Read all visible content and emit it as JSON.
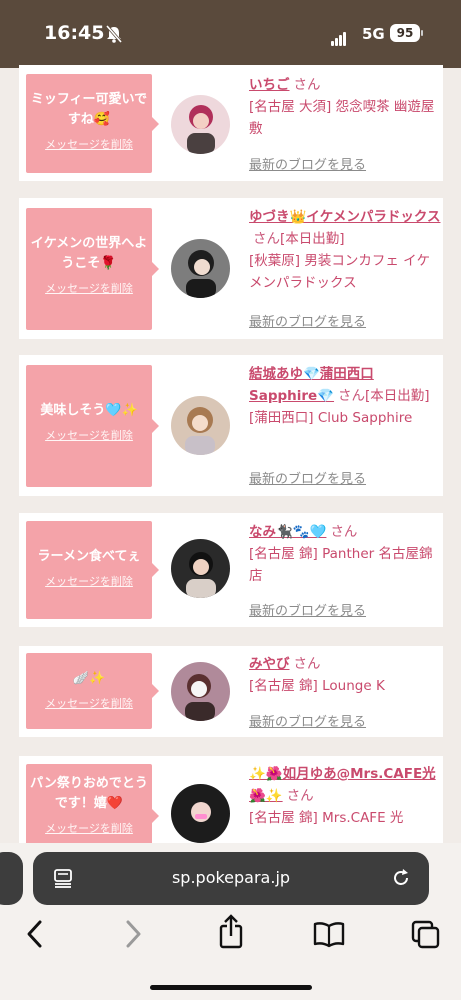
{
  "status": {
    "time": "16:45",
    "network": "5G",
    "battery": "95"
  },
  "cards": [
    {
      "message": "ミッフィー可愛いですね🥰",
      "delete_label": "メッセージを削除",
      "name": "いちご",
      "san": "さん",
      "detail": "[名古屋 大須] 怨念喫茶 幽遊屋敷",
      "blog_link": "最新のブログを見る"
    },
    {
      "message": "イケメンの世界へようこそ🌹",
      "delete_label": "メッセージを削除",
      "name": "ゆづき👑イケメンパラドックス",
      "san": "さん",
      "note": "[本日出勤]",
      "detail": "[秋葉原] 男装コンカフェ イケメンパラドックス",
      "blog_link": "最新のブログを見る"
    },
    {
      "message": "美味しそう🩵✨",
      "delete_label": "メッセージを削除",
      "name": "結城あゆ💎蒲田西口Sapphire💎",
      "san": "さん",
      "note": "[本日出勤]",
      "detail": "[蒲田西口] Club Sapphire",
      "blog_link": "最新のブログを見る"
    },
    {
      "message": "ラーメン食べてぇ",
      "delete_label": "メッセージを削除",
      "name": "なみ🐈‍⬛🐾🩵",
      "san": "さん",
      "detail": "[名古屋 錦] Panther 名古屋錦店",
      "blog_link": "最新のブログを見る"
    },
    {
      "message": "🪽✨",
      "delete_label": "メッセージを削除",
      "name": "みやび",
      "san": "さん",
      "detail": "[名古屋 錦] Lounge K",
      "blog_link": "最新のブログを見る"
    },
    {
      "message": "パン祭りおめでとうです！嬉❤️",
      "delete_label": "メッセージを削除",
      "name": "✨🌺如月ゆあ@Mrs.CAFE光🌺✨",
      "san": "さん",
      "detail": "[名古屋 錦] Mrs.CAFE 光"
    }
  ],
  "browser": {
    "url": "sp.pokepara.jp"
  },
  "colors": {
    "status_bar": "#5a4a3c",
    "bubble": "#f4a3a9",
    "name": "#c94a6d",
    "page_bg": "#f1ece8"
  }
}
